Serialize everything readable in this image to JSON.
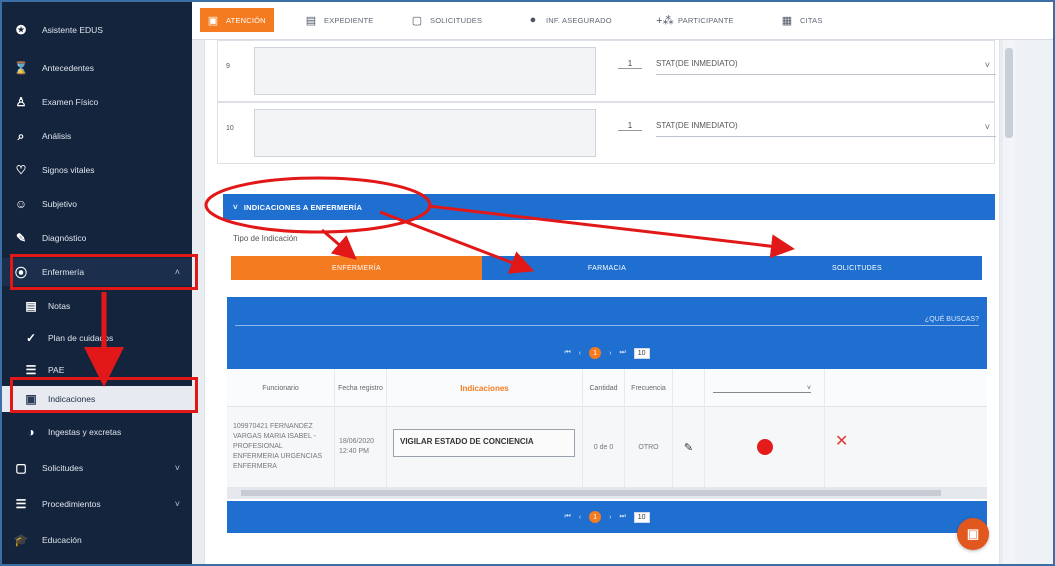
{
  "sidebar": {
    "items": [
      {
        "label": "Asistente EDUS",
        "icon": "robot-icon"
      },
      {
        "label": "Antecedentes",
        "icon": "hourglass-icon"
      },
      {
        "label": "Examen Físico",
        "icon": "person-icon"
      },
      {
        "label": "Análisis",
        "icon": "magnifier-icon"
      },
      {
        "label": "Signos vitales",
        "icon": "heart-icon"
      },
      {
        "label": "Subjetivo",
        "icon": "face-icon"
      },
      {
        "label": "Diagnóstico",
        "icon": "pencil-icon"
      },
      {
        "label": "Enfermería",
        "icon": "location-pin-icon"
      },
      {
        "label": "Notas",
        "icon": "document-icon"
      },
      {
        "label": "Plan de cuidados",
        "icon": "checkmark-icon"
      },
      {
        "label": "PAE",
        "icon": "list-icon"
      },
      {
        "label": "Indicaciones",
        "icon": "briefcase-icon"
      },
      {
        "label": "Ingestas y excretas",
        "icon": "half-circle-icon"
      },
      {
        "label": "Solicitudes",
        "icon": "square-icon"
      },
      {
        "label": "Procedimientos",
        "icon": "list-icon"
      },
      {
        "label": "Educación",
        "icon": "graduation-cap-icon"
      }
    ]
  },
  "topbar": {
    "tabs": [
      {
        "label": "ATENCIÓN",
        "icon": "briefcase-icon"
      },
      {
        "label": "EXPEDIENTE",
        "icon": "folder-icon"
      },
      {
        "label": "SOLICITUDES",
        "icon": "square-icon"
      },
      {
        "label": "INF. ASEGURADO",
        "icon": "user-icon"
      },
      {
        "label": "PARTICIPANTE",
        "icon": "add-group-icon"
      },
      {
        "label": "CITAS",
        "icon": "calendar-icon"
      }
    ]
  },
  "prescriptions": [
    {
      "number": "9",
      "qty": "1",
      "frequency": "STAT(DE INMEDIATO)"
    },
    {
      "number": "10",
      "qty": "1",
      "frequency": "STAT(DE INMEDIATO)"
    }
  ],
  "section": {
    "title": "INDICACIONES A ENFERMERÍA",
    "tipo_label": "Tipo de Indicación",
    "segments": [
      "ENFERMERÍA",
      "FARMACIA",
      "SOLICITUDES"
    ]
  },
  "grid": {
    "search_placeholder": "¿QUÉ BUSCAS?",
    "pager": {
      "first": "⏮",
      "prev": "‹",
      "current": "1",
      "next": "›",
      "last": "⏭",
      "size": "10"
    },
    "headers": {
      "funcionario": "Funcionario",
      "fecha": "Fecha registro",
      "indicaciones": "Indicaciones",
      "cantidad": "Cantidad",
      "frecuencia": "Frecuencia"
    },
    "row": {
      "funcionario": "109970421 FERNANDEZ VARGAS MARIA ISABEL - PROFESIONAL ENFERMERIA URGENCIAS ENFERMERA",
      "fecha": "18/06/2020 12:40 PM",
      "indicacion": "VIGILAR ESTADO DE CONCIENCIA",
      "cantidad": "0 de 0",
      "frecuencia": "OTRO"
    }
  },
  "colors": {
    "sidebar_bg": "#14243d",
    "accent_orange": "#f47b20",
    "primary_blue": "#1f6fd1",
    "annotation_red": "#e21818",
    "status_red": "#e41b1b"
  }
}
